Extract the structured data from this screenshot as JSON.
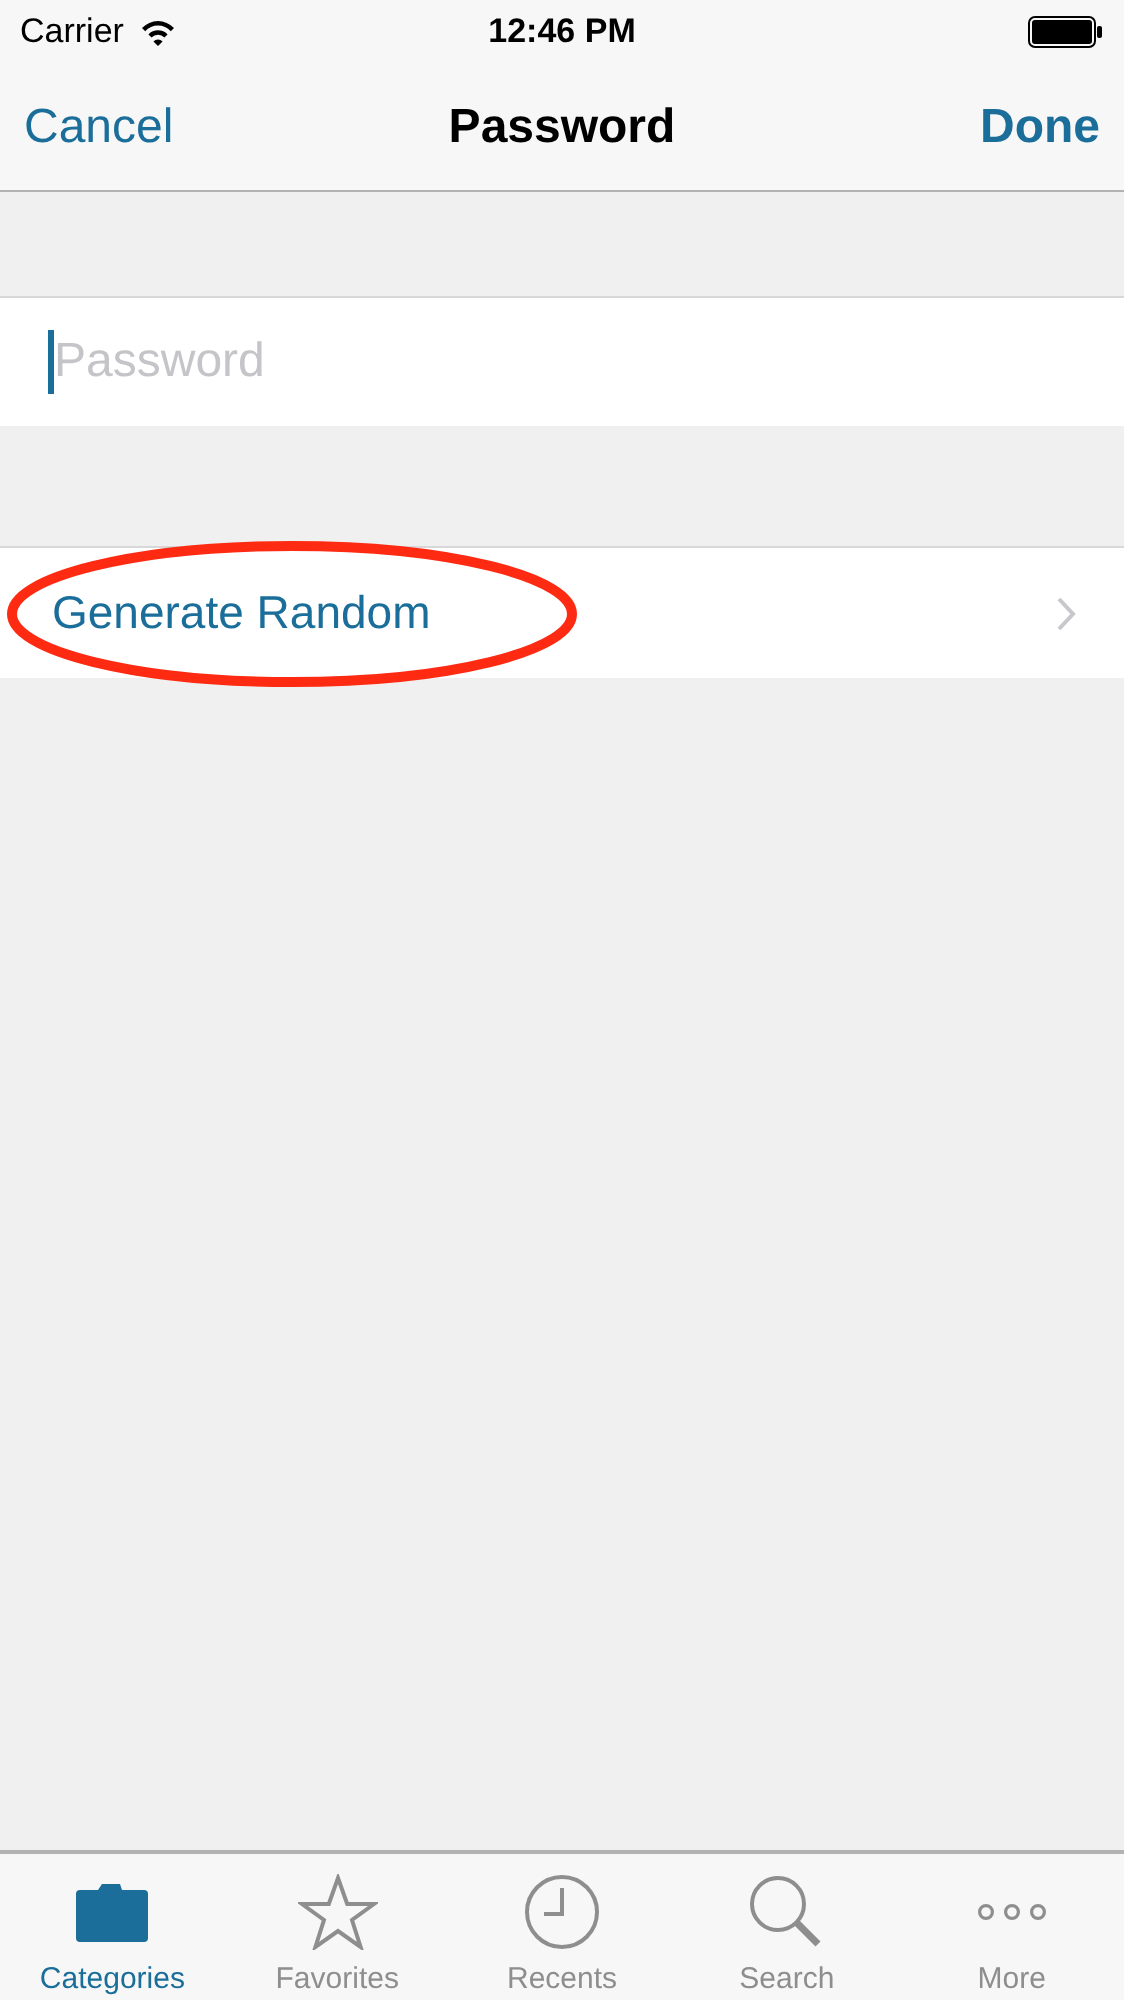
{
  "status_bar": {
    "carrier": "Carrier",
    "time": "12:46 PM"
  },
  "nav_bar": {
    "left": "Cancel",
    "title": "Password",
    "right": "Done"
  },
  "password_field": {
    "placeholder": "Password"
  },
  "rows": [
    {
      "label": "Generate Random",
      "circled": true
    }
  ],
  "tab_bar": [
    {
      "label": "Categories",
      "kind": "folder",
      "selected": true
    },
    {
      "label": "Favorites",
      "kind": "star",
      "selected": false
    },
    {
      "label": "Recents",
      "kind": "clock",
      "selected": false
    },
    {
      "label": "Search",
      "kind": "search",
      "selected": false
    },
    {
      "label": "More",
      "kind": "more",
      "selected": false
    }
  ]
}
